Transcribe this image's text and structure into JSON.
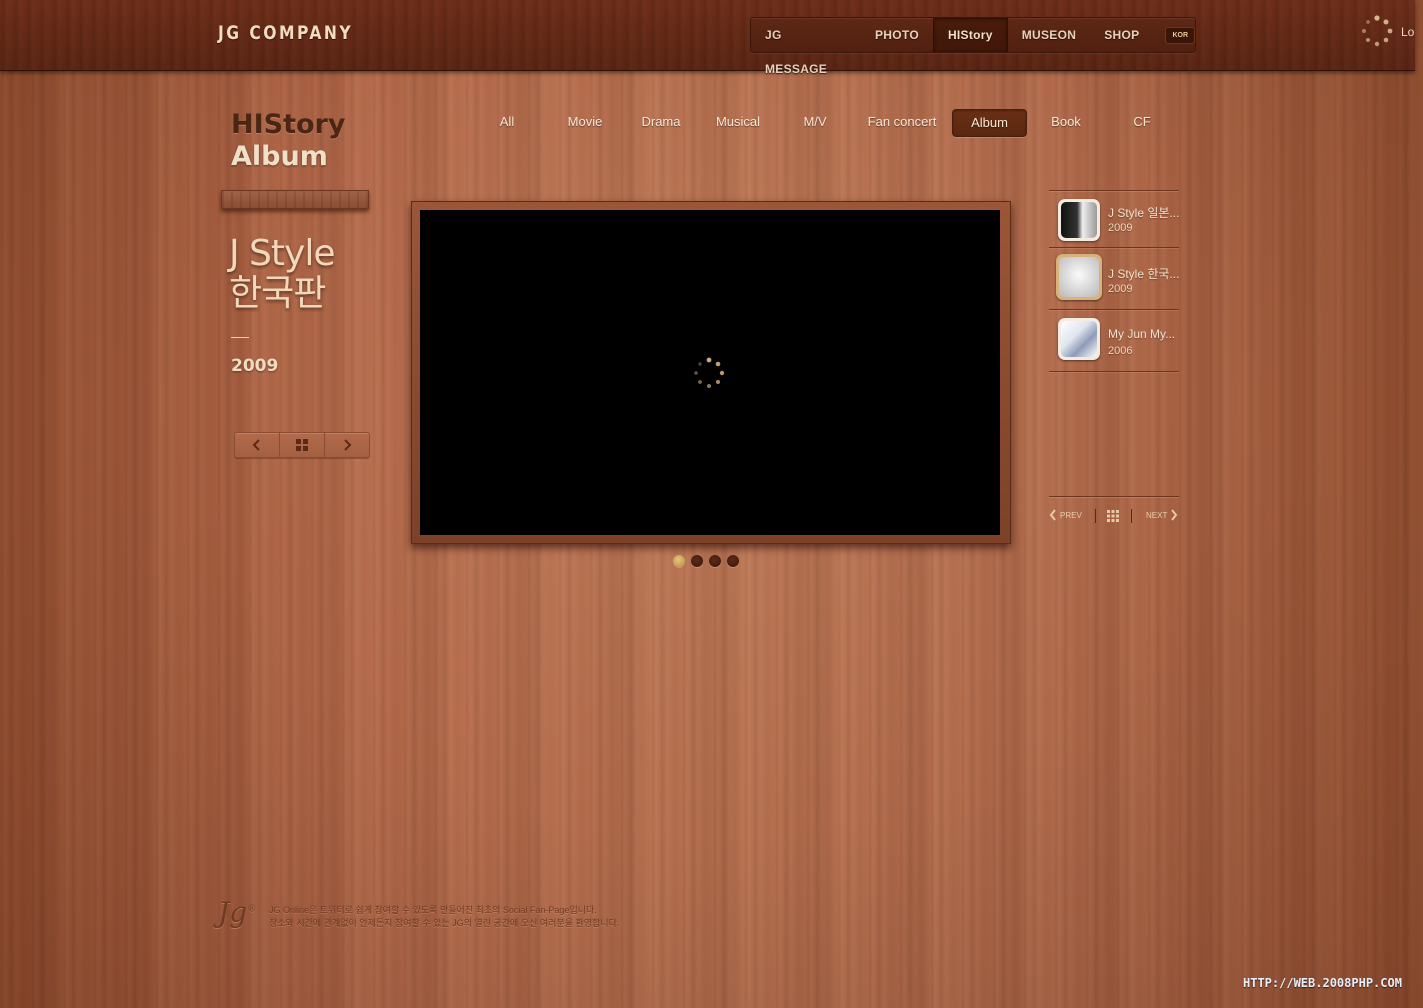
{
  "header": {
    "logo": "JG COMPANY",
    "nav": [
      {
        "label": "JG MESSAGE",
        "active": false
      },
      {
        "label": "PHOTO",
        "active": false
      },
      {
        "label": "HIStory",
        "active": true
      },
      {
        "label": "MUSEON",
        "active": false
      },
      {
        "label": "SHOP",
        "active": false
      }
    ],
    "lang_badge": "KOR",
    "loading_text": "Lo"
  },
  "section": {
    "title_line1": "HIStory",
    "title_line2": "Album"
  },
  "album": {
    "title_line1": "J Style",
    "title_line2": "한국판",
    "year": "2009"
  },
  "pager_icons": [
    "chevron-left-icon",
    "grid-icon",
    "chevron-right-icon"
  ],
  "categories": [
    {
      "label": "All",
      "active": false
    },
    {
      "label": "Movie",
      "active": false
    },
    {
      "label": "Drama",
      "active": false
    },
    {
      "label": "Musical",
      "active": false
    },
    {
      "label": "M/V",
      "active": false
    },
    {
      "label": "Fan concert",
      "active": false
    },
    {
      "label": "Album",
      "active": true
    },
    {
      "label": "Book",
      "active": false
    },
    {
      "label": "CF",
      "active": false
    }
  ],
  "viewer": {
    "slide_count": 4,
    "active_slide": 1
  },
  "album_list": [
    {
      "title": "J Style 일본...",
      "year": "2009",
      "selected": false
    },
    {
      "title": "J Style 한국...",
      "year": "2009",
      "selected": true
    },
    {
      "title": "My Jun My...",
      "year": "2006",
      "selected": false
    }
  ],
  "list_nav": {
    "prev": "PREV",
    "next": "NEXT"
  },
  "footer": {
    "logo": "Jg",
    "line1": "JG Online은 트위터로 쉽게 참여할 수 있도록 만들어진 최초의 Social Fan-Page입니다.",
    "line2": "장소와 시간에 관계없이 언제든지 참여할 수 있는 JG의 열린 공간에 오신 여러분을 환영합니다."
  },
  "watermark": "HTTP://WEB.2008PHP.COM",
  "colors": {
    "wood": "#b4694a",
    "header": "#5e2816",
    "active_tab": "#5a2710",
    "active_dot": "#d8b86e"
  }
}
